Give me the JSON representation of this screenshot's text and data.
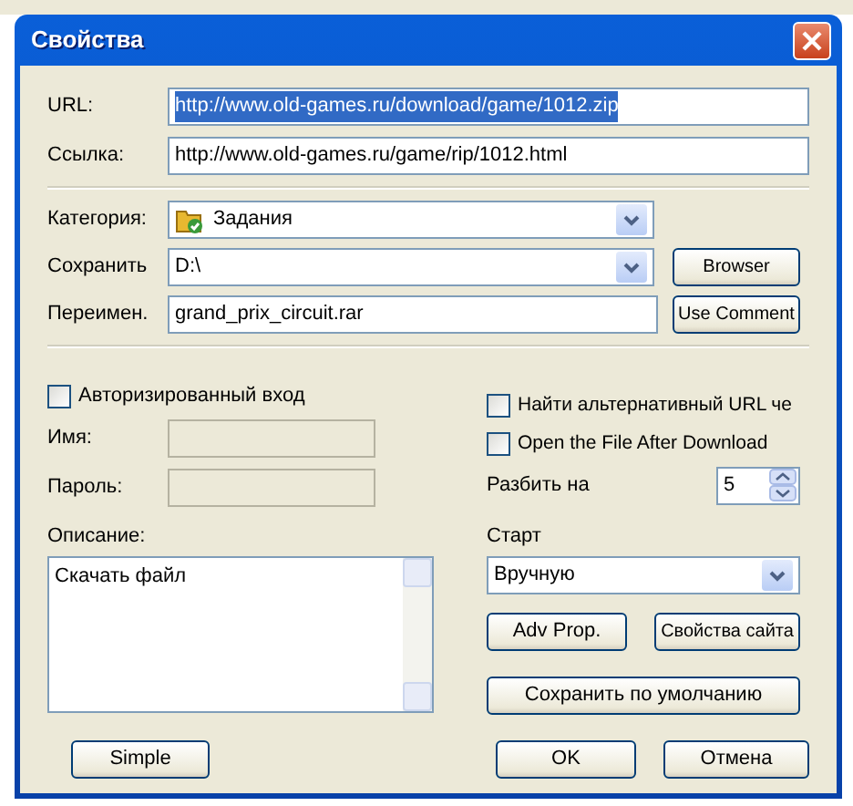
{
  "window": {
    "title": "Свойства"
  },
  "links": [
    {
      "label": "URL:",
      "value": "http://www.old-games.ru/download/game/1012.zip",
      "text_selected": true
    },
    {
      "label": "Ссылка:",
      "value": "http://www.old-games.ru/game/rip/1012.html",
      "text_selected": false
    }
  ],
  "save_rows": [
    {
      "label": "Категория:",
      "kind": "combo",
      "value": "Задания",
      "icon": true
    },
    {
      "label": "Сохранить",
      "kind": "combo",
      "value": "D:\\",
      "button": "Browser"
    },
    {
      "label": "Переимен.",
      "kind": "input",
      "value": "grand_prix_circuit.rar",
      "button": "Use Comment"
    }
  ],
  "login": {
    "checkbox": {
      "label": "Авторизированный вход",
      "checked": false
    },
    "fields": [
      {
        "label": "Имя:",
        "disabled": true
      },
      {
        "label": "Пароль:",
        "disabled": true
      }
    ]
  },
  "description": {
    "label": "Описание:",
    "value": "Скачать файл"
  },
  "options": [
    {
      "label": "Найти альтернативный URL че",
      "checked": false
    },
    {
      "label": "Open the File After Download",
      "checked": false
    }
  ],
  "split": {
    "label": "Разбить на",
    "value": "5"
  },
  "start": {
    "label": "Старт",
    "value": "Вручную"
  },
  "buttons": [
    {
      "label": "Adv Prop.",
      "kind": "half"
    },
    {
      "label": "Свойства сайта",
      "kind": "half"
    },
    {
      "label": "Сохранить по умолчанию",
      "kind": "wide"
    }
  ],
  "footer": {
    "left": "Simple",
    "right": [
      "OK",
      "Отмена"
    ]
  }
}
